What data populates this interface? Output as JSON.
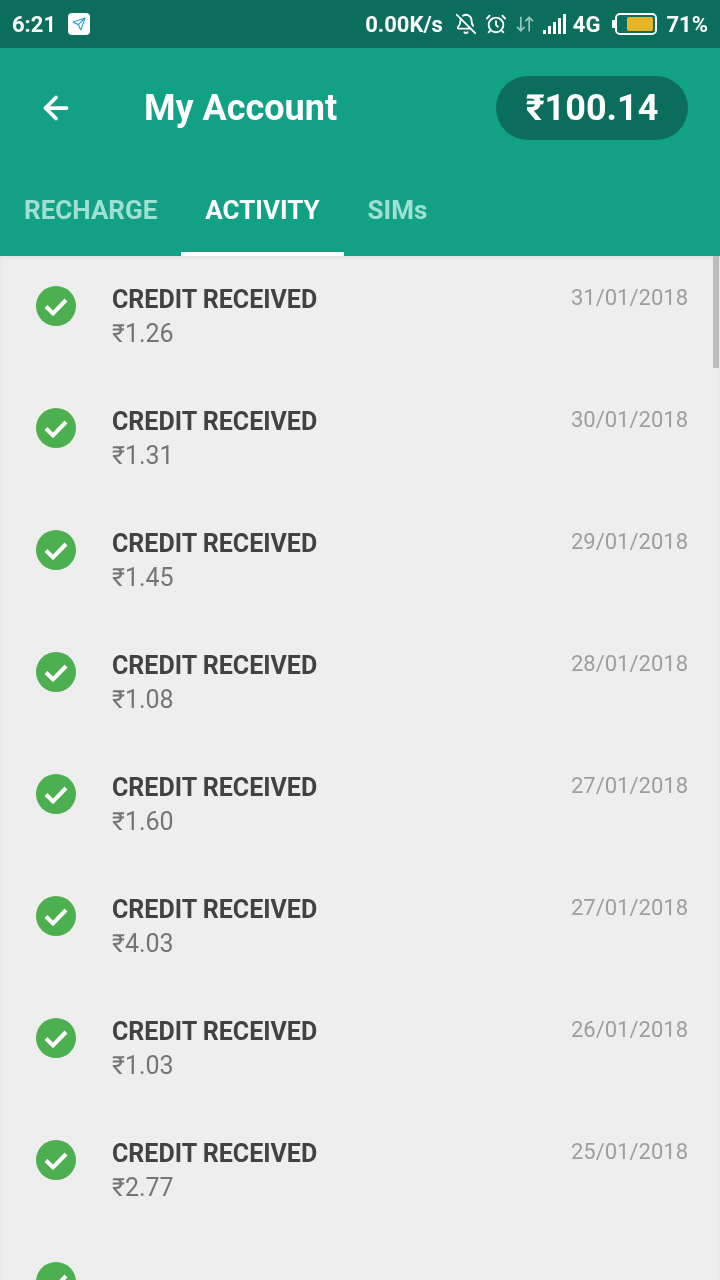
{
  "status_bar": {
    "time": "6:21",
    "speed": "0.00K/s",
    "network": "4G",
    "battery": "71%"
  },
  "header": {
    "title": "My Account",
    "balance": "₹100.14"
  },
  "tabs": [
    {
      "label": "RECHARGE",
      "selected": false
    },
    {
      "label": "ACTIVITY",
      "selected": true
    },
    {
      "label": "SIMs",
      "selected": false
    }
  ],
  "activity": [
    {
      "title": "CREDIT RECEIVED",
      "amount": "₹1.26",
      "date": "31/01/2018"
    },
    {
      "title": "CREDIT RECEIVED",
      "amount": "₹1.31",
      "date": "30/01/2018"
    },
    {
      "title": "CREDIT RECEIVED",
      "amount": "₹1.45",
      "date": "29/01/2018"
    },
    {
      "title": "CREDIT RECEIVED",
      "amount": "₹1.08",
      "date": "28/01/2018"
    },
    {
      "title": "CREDIT RECEIVED",
      "amount": "₹1.60",
      "date": "27/01/2018"
    },
    {
      "title": "CREDIT RECEIVED",
      "amount": "₹4.03",
      "date": "27/01/2018"
    },
    {
      "title": "CREDIT RECEIVED",
      "amount": "₹1.03",
      "date": "26/01/2018"
    },
    {
      "title": "CREDIT RECEIVED",
      "amount": "₹2.77",
      "date": "25/01/2018"
    }
  ]
}
